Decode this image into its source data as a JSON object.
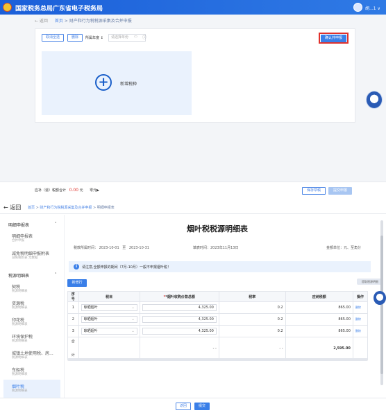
{
  "topbar": {
    "title": "国家税务总局广东省电子税务局",
    "user": "胡...1 ∨"
  },
  "top_page": {
    "back": "← 返回",
    "breadcrumb_home": "首页",
    "breadcrumb_sep": " > ",
    "breadcrumb_current": "财产和行为税税源采集及合并申报",
    "btn_cancel_all": "取消全选",
    "btn_delete": "删除",
    "year_label": "所属年度 ↕",
    "year_placeholder": "请选择年份",
    "btn_merge_declare": "确认并申报",
    "add_tax_label": "新增税种",
    "footer_label": "应补（退）税额合计",
    "footer_amount": "0.00",
    "footer_unit": "元",
    "footer_extra": "零元▶",
    "btn_save_draft": "保存草稿",
    "btn_next": "提交申报"
  },
  "bottom_page": {
    "back": "← 返回",
    "breadcrumb_home": "首页",
    "breadcrumb_mid": "财产和行为税税源采集及合并申报",
    "breadcrumb_current": "明细申报表",
    "sidebar": {
      "group1": "明细申报表",
      "group1_items": [
        {
          "label": "明细申报表",
          "sub": "合并申报"
        },
        {
          "label": "减免税明细申报附表",
          "sub": "减免税附表 无数据"
        }
      ],
      "group2": "税源明细表",
      "group2_items": [
        {
          "label": "契税",
          "sub": "税源明细表"
        },
        {
          "label": "资源税",
          "sub": "税源明细表"
        },
        {
          "label": "印花税",
          "sub": "税源明细表"
        },
        {
          "label": "环境保护税",
          "sub": "税源明细表"
        },
        {
          "label": "城镇土地使用税、房...",
          "sub": "税源明细表"
        },
        {
          "label": "车船税",
          "sub": "税源明细表"
        },
        {
          "label": "烟叶税",
          "sub": "税源明细表"
        }
      ]
    },
    "title": "烟叶税税源明细表",
    "period_label": "税款所属时间：",
    "period_from": "2023-10-01",
    "period_to_word": "至",
    "period_to": "2023-10-31",
    "fill_date": "填表时间：2023年11月13日",
    "unit": "金额单位：元、至角分",
    "notice": "请注意,全额申报的期间（7月-10月）一般不申报烟叶税！",
    "btn_add_row": "新增行",
    "pill": "提取税源明细",
    "table": {
      "headers": [
        "序号",
        "税目",
        "*烟叶收购价款总额",
        "税率",
        "应纳税额",
        "操作"
      ],
      "rows": [
        {
          "no": "1",
          "item": "晾晒烟叶",
          "amount": "4,325.00",
          "rate": "0.2",
          "tax": "865.00",
          "op": "删除"
        },
        {
          "no": "2",
          "item": "晾晒烟叶",
          "amount": "4,325.00",
          "rate": "0.2",
          "tax": "865.00",
          "op": "删除"
        },
        {
          "no": "3",
          "item": "晾晒烟叶",
          "amount": "4,325.00",
          "rate": "0.2",
          "tax": "865.00",
          "op": "删除"
        }
      ],
      "total_label_1": "合",
      "total_label_2": "计",
      "total_amount": "- -",
      "total_rate": "- -",
      "total_tax": "2,595.00"
    },
    "btn_back": "返回",
    "btn_submit": "提交"
  }
}
